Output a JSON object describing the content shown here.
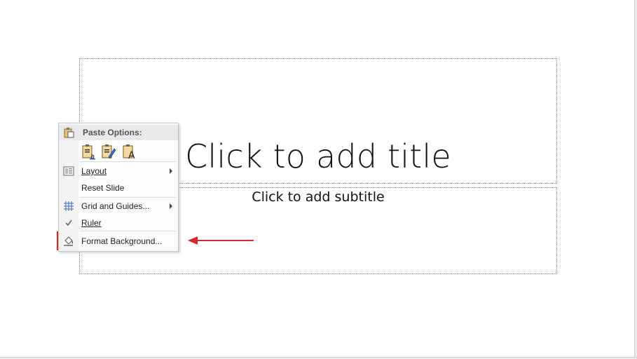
{
  "slide": {
    "title_placeholder": "Click to add title",
    "subtitle_placeholder": "Click to add subtitle"
  },
  "context_menu": {
    "paste_options_label": "Paste Options:",
    "paste_icons": [
      "paste-use-destination-theme-icon",
      "paste-keep-source-formatting-icon",
      "paste-keep-text-only-icon"
    ],
    "items": [
      {
        "label": "Layout",
        "has_submenu": true,
        "icon": "layout-icon"
      },
      {
        "label": "Reset Slide",
        "has_submenu": false,
        "icon": ""
      },
      {
        "label": "Grid and Guides...",
        "has_submenu": true,
        "icon": "grid-icon"
      },
      {
        "label": "Ruler",
        "has_submenu": false,
        "icon": "checkmark-icon",
        "checked": true
      },
      {
        "label": "Format Background...",
        "has_submenu": false,
        "icon": "paint-bucket-icon",
        "highlighted": true
      }
    ]
  },
  "annotation": {
    "highlight_color": "#d62828",
    "arrow_color": "#d62828"
  }
}
